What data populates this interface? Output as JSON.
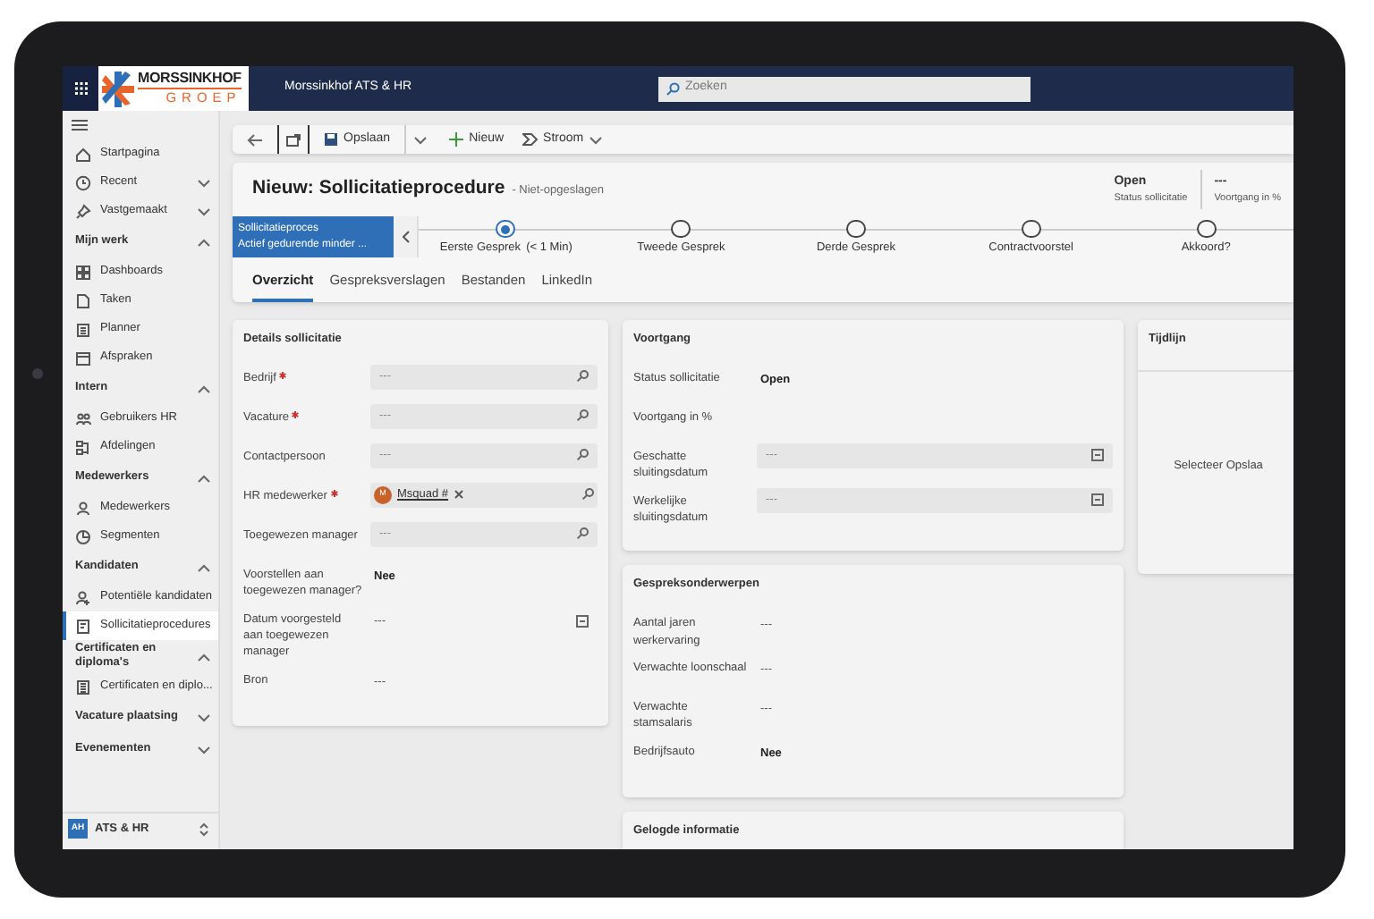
{
  "app": {
    "logo_top": "MORSSINKHOF",
    "logo_bottom": "GROEP",
    "title": "Morssinkhof ATS & HR"
  },
  "search": {
    "placeholder": "Zoeken"
  },
  "sidebar": {
    "items": [
      {
        "kind": "link",
        "label": "Startpagina",
        "selected": false
      },
      {
        "kind": "expandable",
        "label": "Recent",
        "expanded": false
      },
      {
        "kind": "expandable",
        "label": "Vastgemaakt",
        "expanded": false
      },
      {
        "kind": "section",
        "label": "Mijn werk",
        "expanded": true,
        "children": [
          {
            "kind": "link",
            "label": "Dashboards",
            "selected": false
          },
          {
            "kind": "link",
            "label": "Taken",
            "selected": false
          },
          {
            "kind": "link",
            "label": "Planner",
            "selected": false
          },
          {
            "kind": "link",
            "label": "Afspraken",
            "selected": false
          }
        ]
      },
      {
        "kind": "section",
        "label": "Intern",
        "expanded": true,
        "children": [
          {
            "kind": "link",
            "label": "Gebruikers HR",
            "selected": false
          },
          {
            "kind": "link",
            "label": "Afdelingen",
            "selected": false
          }
        ]
      },
      {
        "kind": "section",
        "label": "Medewerkers",
        "expanded": true,
        "children": [
          {
            "kind": "link",
            "label": "Medewerkers",
            "selected": false
          },
          {
            "kind": "link",
            "label": "Segmenten",
            "selected": false
          }
        ]
      },
      {
        "kind": "section",
        "label": "Kandidaten",
        "expanded": true,
        "children": [
          {
            "kind": "link",
            "label": "Potentiële kandidaten",
            "selected": false
          },
          {
            "kind": "link",
            "label": "Sollicitatieprocedures",
            "selected": true
          }
        ]
      },
      {
        "kind": "section",
        "label": "Certificaten en diploma's",
        "expanded": true,
        "children": [
          {
            "kind": "link",
            "label": "Certificaten en diplo...",
            "selected": false
          }
        ]
      },
      {
        "kind": "section",
        "label": "Vacature plaatsing",
        "expanded": false
      },
      {
        "kind": "section",
        "label": "Evenementen",
        "expanded": false
      }
    ],
    "footer": {
      "badge": "AH",
      "label": "ATS & HR"
    }
  },
  "command_bar": {
    "buttons": [
      {
        "kind": "back"
      },
      {
        "kind": "popout"
      },
      {
        "kind": "save",
        "label": "Opslaan"
      },
      {
        "kind": "dropdown"
      },
      {
        "kind": "new",
        "label": "Nieuw"
      },
      {
        "kind": "flow",
        "label": "Stroom"
      }
    ]
  },
  "header": {
    "title": "Nieuw: Sollicitatieprocedure",
    "subtitle": "- Niet-opgeslagen",
    "fields": [
      {
        "value": "Open",
        "label": "Status sollicitatie"
      },
      {
        "value": "---",
        "label": "Voortgang in %"
      }
    ]
  },
  "process": {
    "name": "Sollicitatieproces",
    "status": "Actief gedurende minder ...",
    "stages": [
      {
        "label": "Eerste Gesprek",
        "duration": "(< 1 Min)",
        "selected": true
      },
      {
        "label": "Tweede Gesprek",
        "selected": false
      },
      {
        "label": "Derde Gesprek",
        "selected": false
      },
      {
        "label": "Contractvoorstel",
        "selected": false
      },
      {
        "label": "Akkoord?",
        "selected": false
      }
    ]
  },
  "tabs": [
    {
      "label": "Overzicht",
      "selected": true
    },
    {
      "label": "Gespreksverslagen",
      "selected": false
    },
    {
      "label": "Bestanden",
      "selected": false
    },
    {
      "label": "LinkedIn",
      "selected": false
    }
  ],
  "columns": [
    {
      "sections": [
        {
          "title": "Details sollicitatie",
          "fields": [
            {
              "label": "Bedrijf",
              "required": true,
              "kind": "lookup",
              "placeholder": "---"
            },
            {
              "label": "Vacature",
              "required": true,
              "kind": "lookup",
              "placeholder": "---"
            },
            {
              "label": "Contactpersoon",
              "required": false,
              "kind": "lookup",
              "placeholder": "---"
            },
            {
              "label": "HR medewerker",
              "required": true,
              "kind": "tag_lookup",
              "tag": {
                "initial": "M",
                "text": "Msquad #"
              }
            },
            {
              "label": "Toegewezen manager",
              "required": false,
              "kind": "lookup",
              "placeholder": "---"
            },
            {
              "label": "Voorstellen aan toegewezen manager?",
              "required": false,
              "kind": "plain",
              "value": "Nee",
              "filled": true
            },
            {
              "label": "Datum voorgesteld aan toegewezen manager",
              "required": false,
              "kind": "plain_date",
              "value": "---",
              "filled": false
            },
            {
              "label": "Bron",
              "required": false,
              "kind": "plain",
              "value": "---",
              "filled": false
            }
          ]
        }
      ]
    },
    {
      "sections": [
        {
          "title": "Voortgang",
          "fields": [
            {
              "label": "Status sollicitatie",
              "required": false,
              "kind": "plain",
              "value": "Open",
              "filled": true
            },
            {
              "label": "Voortgang in %",
              "required": false,
              "kind": "plain"
            },
            {
              "label": "Geschatte sluitingsdatum",
              "required": false,
              "kind": "date",
              "placeholder": "---"
            },
            {
              "label": "Werkelijke sluitingsdatum",
              "required": false,
              "kind": "date",
              "placeholder": "---"
            }
          ]
        },
        {
          "title": "Gespreksonderwerpen",
          "fields": [
            {
              "label": "Aantal jaren werkervaring",
              "required": false,
              "kind": "plain",
              "value": "---",
              "filled": false
            },
            {
              "label": "Verwachte loonschaal",
              "required": false,
              "kind": "plain",
              "value": "---",
              "filled": false
            },
            {
              "label": "Verwachte stamsalaris",
              "required": false,
              "kind": "plain",
              "value": "---",
              "filled": false
            },
            {
              "label": "Bedrijfsauto",
              "required": false,
              "kind": "plain",
              "value": "Nee",
              "filled": true
            }
          ]
        },
        {
          "title": "Gelogde informatie"
        }
      ]
    },
    {
      "sections": [
        {
          "title": "Tijdlijn",
          "message": "Selecteer Opslaa"
        }
      ]
    }
  ]
}
